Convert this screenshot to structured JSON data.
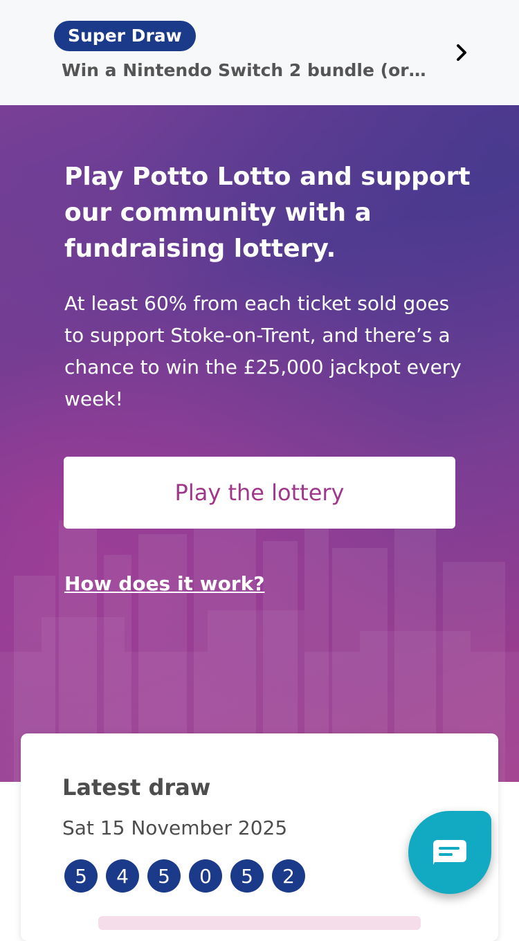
{
  "banner": {
    "badge": "Super Draw",
    "text": "Win a Nintendo Switch 2 bundle (or c…",
    "chevron_icon": "chevron-right-icon"
  },
  "hero": {
    "title": "Play Potto Lotto and support our community with a fundraising lottery.",
    "body": "At least 60% from each ticket sold goes to support Stoke-on-Trent, and there’s a chance to win the £25,000 jackpot every week!",
    "play_button": "Play the lottery",
    "how_link": "How does it work?"
  },
  "latest_draw": {
    "title": "Latest draw",
    "date": "Sat 15 November 2025",
    "numbers": [
      "5",
      "4",
      "5",
      "0",
      "5",
      "2"
    ]
  },
  "chat": {
    "icon": "chat-icon"
  },
  "colors": {
    "badge": "#1c3a8a",
    "ball": "#1c3a8a",
    "accent_text": "#a0378a",
    "chat": "#12aac2"
  }
}
